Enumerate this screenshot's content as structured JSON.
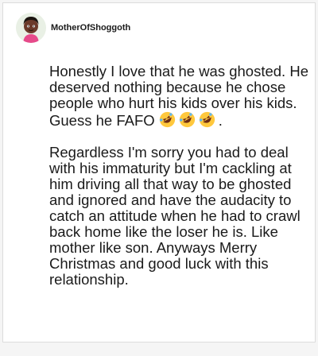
{
  "post": {
    "username": "MotherOfShoggoth",
    "avatar_icon": "cartoon-person-avatar-icon",
    "paragraph1_text": "Honestly I love that he was ghosted. He deserved nothing because he chose people who hurt his kids over his kids. Guess he FAFO",
    "paragraph1_emoji": "rolling-on-floor-laughing-emoji",
    "paragraph1_emoji_count": 3,
    "paragraph1_end": ".",
    "paragraph2_text": "Regardless I'm sorry you had to deal with his immaturity but I'm cackling at him driving all that way to be ghosted and ignored and have the audacity to catch an attitude when he had to crawl back home like the loser he is. Like mother like son. Anyways Merry Christmas and good luck with this relationship."
  }
}
